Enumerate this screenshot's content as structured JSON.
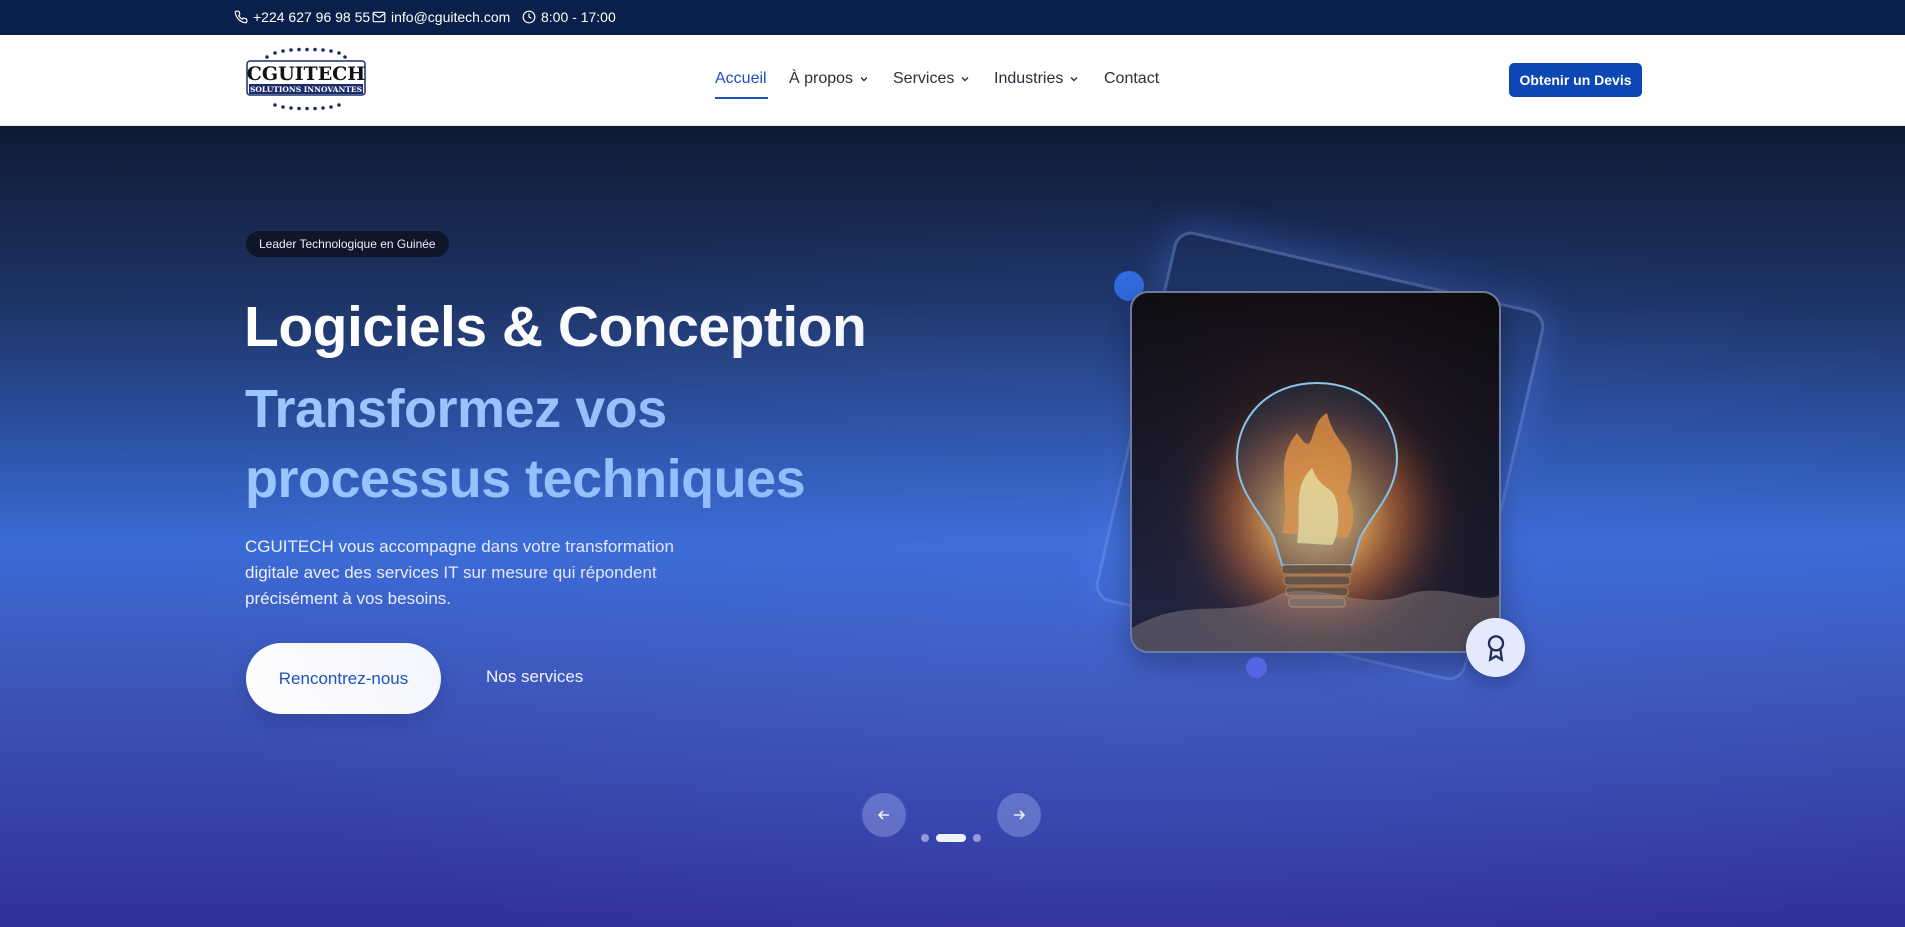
{
  "topbar": {
    "phone": "+224 627 96 98 55",
    "email": "info@cguitech.com",
    "hours": "8:00 - 17:00"
  },
  "logo": {
    "name": "CGUITECH",
    "tagline": "SOLUTIONS INNOVANTES"
  },
  "nav": {
    "items": [
      {
        "label": "Accueil",
        "active": true,
        "dropdown": false
      },
      {
        "label": "À propos",
        "active": false,
        "dropdown": true
      },
      {
        "label": "Services",
        "active": false,
        "dropdown": true
      },
      {
        "label": "Industries",
        "active": false,
        "dropdown": true
      },
      {
        "label": "Contact",
        "active": false,
        "dropdown": false
      }
    ],
    "cta": "Obtenir un Devis"
  },
  "hero": {
    "badge": "Leader Technologique en Guinée",
    "title": "Logiciels & Conception",
    "subtitle": "Transformez vos processus techniques",
    "description": "CGUITECH vous accompagne dans votre transformation digitale avec des services IT sur mesure qui répondent précisément à vos besoins.",
    "primary_button": "Rencontrez-nous",
    "secondary_button": "Nos services"
  },
  "slider": {
    "total_slides": 3,
    "active_slide": 2
  },
  "colors": {
    "topbar": "#0a1f4a",
    "brand_blue": "#0d47b4",
    "accent_light": "#9cc6ff"
  },
  "icons": [
    "phone-icon",
    "mail-icon",
    "clock-icon",
    "chevron-down-icon",
    "award-icon",
    "arrow-left-icon",
    "arrow-right-icon"
  ]
}
